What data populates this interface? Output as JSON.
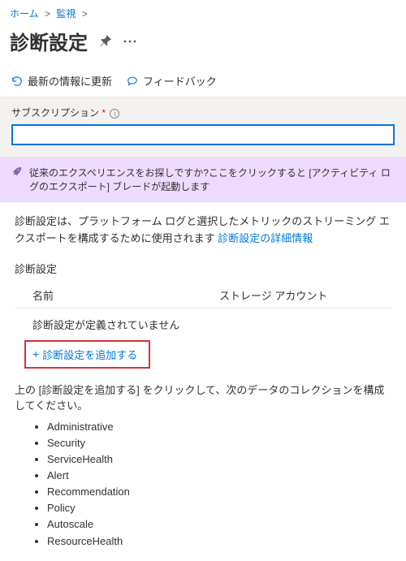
{
  "breadcrumb": {
    "home": "ホーム",
    "monitor": "監視"
  },
  "title": "診断設定",
  "toolbar": {
    "refresh": "最新の情報に更新",
    "feedback": "フィードバック"
  },
  "subscription": {
    "label": "サブスクリプション",
    "required": "*"
  },
  "banner": "従来のエクスペリエンスをお探しですか?ここをクリックすると [アクティビティ ログのエクスポート] ブレードが起動します",
  "desc_pre": "診断設定は、プラットフォーム ログと選択したメトリックのストリーミング エクスポートを構成するために使用されます ",
  "desc_link": "診断設定の詳細情報",
  "section_label": "診断設定",
  "table": {
    "col1": "名前",
    "col2": "ストレージ アカウント",
    "empty": "診断設定が定義されていません"
  },
  "add_label": "診断設定を追加する",
  "instruction": "上の [診断設定を追加する] をクリックして、次のデータのコレクションを構成してください。",
  "bullets": [
    "Administrative",
    "Security",
    "ServiceHealth",
    "Alert",
    "Recommendation",
    "Policy",
    "Autoscale",
    "ResourceHealth"
  ]
}
